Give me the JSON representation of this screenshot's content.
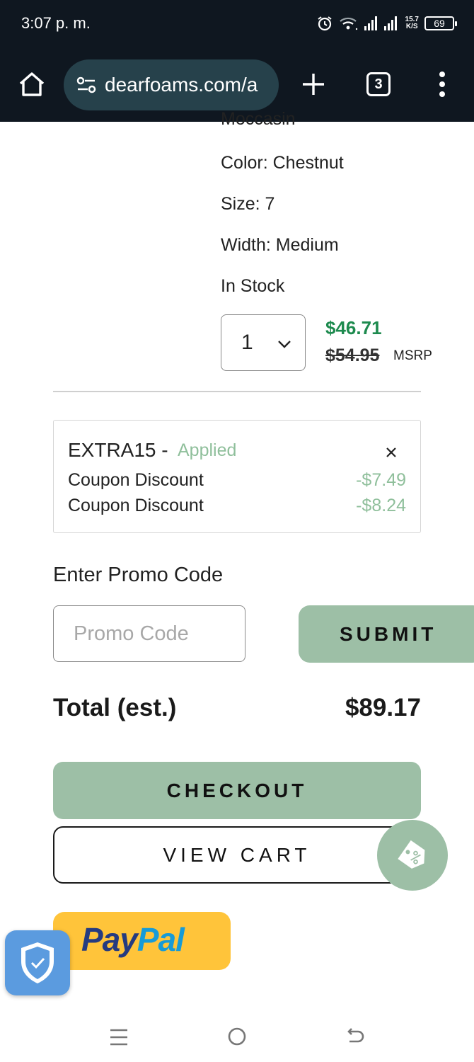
{
  "status_bar": {
    "time": "3:07 p. m.",
    "net_speed_value": "15.7",
    "net_speed_unit": "K/S",
    "battery": "69"
  },
  "browser": {
    "url": "dearfoams.com/a",
    "tab_count": "3"
  },
  "product": {
    "name_fragment": "Moccasin",
    "color": "Color: Chestnut",
    "size": "Size: 7",
    "width": "Width: Medium",
    "stock": "In Stock",
    "quantity": "1",
    "sale_price": "$46.71",
    "msrp_price": "$54.95",
    "msrp_label": "MSRP"
  },
  "coupon": {
    "code": "EXTRA15 -",
    "status": "Applied",
    "discounts": [
      {
        "label": "Coupon Discount",
        "amount": "-$7.49"
      },
      {
        "label": "Coupon Discount",
        "amount": "-$8.24"
      }
    ]
  },
  "promo": {
    "title": "Enter Promo Code",
    "placeholder": "Promo Code",
    "submit_label": "SUBMIT"
  },
  "total": {
    "label": "Total (est.)",
    "value": "$89.17"
  },
  "actions": {
    "checkout_label": "CHECKOUT",
    "view_cart_label": "VIEW CART"
  },
  "paypal": {
    "logo_part1": "Pay",
    "logo_part2": "Pal"
  },
  "colors": {
    "accent_green": "#9dbfa6",
    "sale_green": "#1d8a4e",
    "applied_green": "#8fbf9b",
    "paypal_yellow": "#ffc43a",
    "toolbar_bg": "#0f1720"
  },
  "icons": [
    "alarm-icon",
    "wifi-icon",
    "signal-icon",
    "home-icon",
    "site-settings-icon",
    "new-tab-icon",
    "tab-switcher-icon",
    "more-menu-icon",
    "chevron-down-icon",
    "close-icon",
    "discount-tag-icon",
    "shield-check-icon",
    "recents-icon",
    "home-circle-icon",
    "back-icon"
  ]
}
